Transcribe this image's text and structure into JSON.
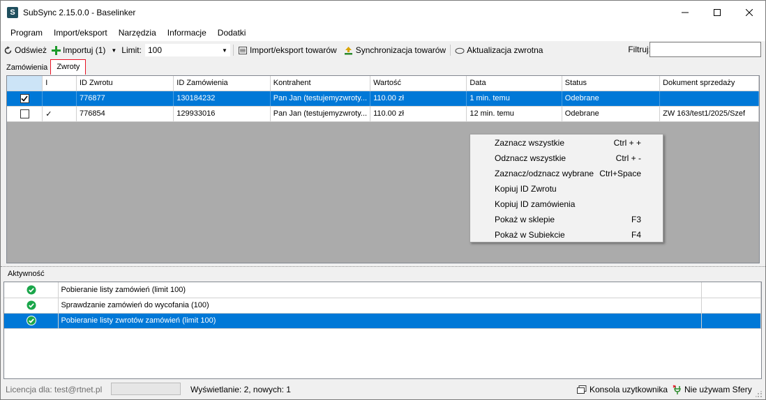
{
  "window": {
    "title": "SubSync 2.15.0.0 - Baselinker",
    "icon_letter": "S"
  },
  "menu": [
    "Program",
    "Import/eksport",
    "Narzędzia",
    "Informacje",
    "Dodatki"
  ],
  "toolbar": {
    "refresh_label": "Odśwież",
    "import_label": "Importuj (1)",
    "limit_label": "Limit:",
    "limit_value": "100",
    "import_export_label": "Import/eksport towarów",
    "sync_label": "Synchronizacja towarów",
    "feedback_label": "Aktualizacja zwrotna",
    "filter_label": "Filtruj:",
    "filter_value": ""
  },
  "tabs": [
    {
      "label": "Zamówienia",
      "active": false
    },
    {
      "label": "Zwroty",
      "active": true
    }
  ],
  "grid": {
    "columns": [
      "",
      "I",
      "ID Zwrotu",
      "ID Zamówienia",
      "Kontrahent",
      "Wartość",
      "Data",
      "Status",
      "Dokument sprzedaży"
    ],
    "rows": [
      {
        "checked": true,
        "flag": "",
        "id_zwrotu": "776877",
        "id_zamowienia": "130184232",
        "kontrahent": "Pan Jan (testujemyzwroty...",
        "wartosc": "110.00 zł",
        "data": "1 min. temu",
        "status": "Odebrane",
        "dokument": "",
        "selected": true
      },
      {
        "checked": false,
        "flag": "✓",
        "id_zwrotu": "776854",
        "id_zamowienia": "129933016",
        "kontrahent": "Pan Jan (testujemyzwroty...",
        "wartosc": "110.00 zł",
        "data": "12 min. temu",
        "status": "Odebrane",
        "dokument": "ZW 163/test1/2025/Szef",
        "selected": false
      }
    ]
  },
  "context_menu": [
    {
      "label": "Zaznacz wszystkie",
      "shortcut": "Ctrl + +"
    },
    {
      "label": "Odznacz wszystkie",
      "shortcut": "Ctrl + -"
    },
    {
      "label": "Zaznacz/odznacz wybrane",
      "shortcut": "Ctrl+Space"
    },
    {
      "label": "Kopiuj ID Zwrotu",
      "shortcut": ""
    },
    {
      "label": "Kopiuj ID zamówienia",
      "shortcut": ""
    },
    {
      "label": "Pokaż w sklepie",
      "shortcut": "F3"
    },
    {
      "label": "Pokaż w Subiekcie",
      "shortcut": "F4"
    }
  ],
  "activity": {
    "label": "Aktywność",
    "rows": [
      {
        "text": "Pobieranie listy zamówień (limit 100)",
        "selected": false
      },
      {
        "text": "Sprawdzanie zamówień do wycofania (100)",
        "selected": false
      },
      {
        "text": "Pobieranie listy zwrotów zamówień (limit 100)",
        "selected": true
      }
    ]
  },
  "status": {
    "license": "Licencja dla: test@rtnet.pl",
    "display": "Wyświetlanie: 2, nowych: 1",
    "console": "Konsola uzytkownika",
    "sfera": "Nie używam Sfery"
  },
  "colors": {
    "selection": "#0078d7",
    "ok_green": "#1aa64a",
    "active_tab_border": "#e81123"
  }
}
